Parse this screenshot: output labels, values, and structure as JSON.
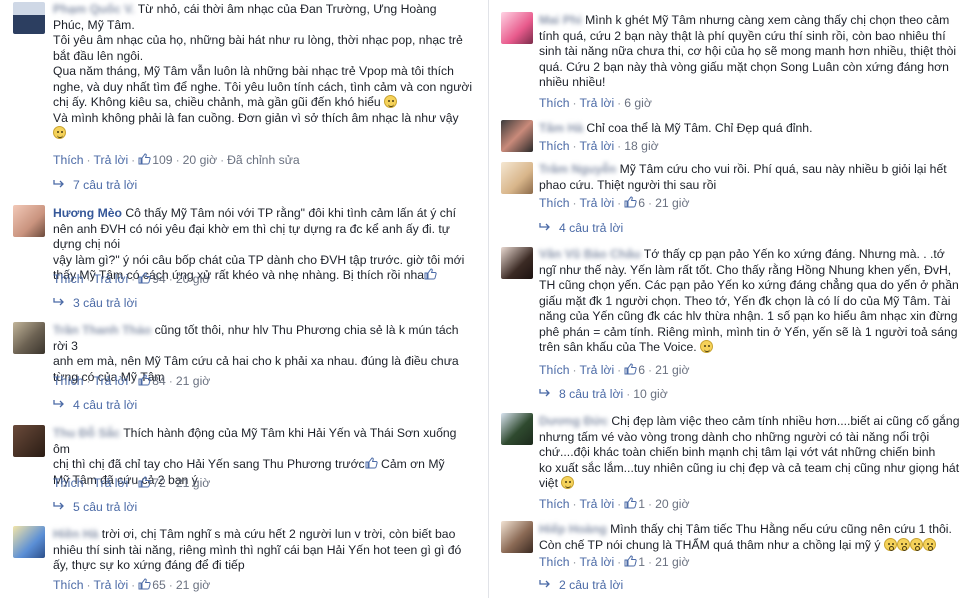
{
  "left": {
    "comments": [
      {
        "name": "Phạm Quốc V.",
        "avatar": "avatar-man",
        "text_lines": [
          "Từ nhỏ, cái thời âm nhạc của Đan Trường, Ưng Hoàng",
          "Phúc, Mỹ Tâm.",
          "Tôi yêu âm nhạc của họ, những bài hát như ru lòng, thời nhạc pop, nhạc trẻ",
          "bắt đầu lên ngôi.",
          "Qua năm tháng, Mỹ Tâm vẫn luôn là những bài nhạc trẻ Vpop mà tôi thích",
          "nghe, và duy nhất tìm để nghe. Tôi yêu luôn tính cách, tình cảm và con người",
          "chị ấy. Không kiêu sa, chiều chảnh, mà gần gũi đến khó hiểu",
          "Và mình không phải là fan cuồng. Đơn giản vì sở thích âm nhạc là như vậy"
        ],
        "like": "Thích",
        "reply": "Trả lời",
        "likes": "109",
        "time": "20 giờ",
        "edited": "Đã chỉnh sửa",
        "replies": "7 câu trả lời"
      },
      {
        "name": "Hương Mèo",
        "avatar": "avatar-girl",
        "text_lines": [
          "Cô thấy Mỹ Tâm nói với TP rằng\" đôi khi tình cảm lấn át ý chí",
          "nên anh ĐVH có nói yêu đại khờ em thì chị tự dựng ra đc",
          "vậy làm gì?\" ý nói câu bốp chát của TP dành cho ĐVH tập trước. giờ tôi mới",
          "thấy Mỹ Tâm có cách ứng xử rất khéo và nhẹ nhàng. Bị thích rồi nha"
        ],
        "text_line_tails": [
          "",
          " kể anh ấy đi. tự dựng chị nói",
          "",
          ""
        ],
        "like": "Thích",
        "reply": "Trả lời",
        "likes": "94",
        "time": "20 giờ",
        "replies": "3 câu trả lời"
      },
      {
        "name": "Trần Thanh Thảo",
        "avatar": "avatar-group",
        "text_lines": [
          "cũng tốt thôi, như hlv Thu Phương chia sẻ là k mún tách rời 3",
          "anh em mà, nên Mỹ Tâm cứu cả hai cho k phải xa nhau. đúng là điều chưa",
          "từng có của Mỹ Tâm"
        ],
        "like": "Thích",
        "reply": "Trả lời",
        "likes": "84",
        "time": "21 giờ",
        "replies": "4 câu trả lời"
      },
      {
        "name": "Thu Đỗ Sắc",
        "avatar": "avatar-dark",
        "text_lines": [
          "Thích hành động của Mỹ Tâm khi Hải Yến và Thái Sơn xuống ôm",
          "chị thì chị đã chỉ tay cho Hải Yến sang Thu Phương trước",
          "Mỹ Tâm đã cứu cả 2 bạn ý"
        ],
        "text_after_like": " Cảm ơn Mỹ",
        "like": "Thích",
        "reply": "Trả lời",
        "likes": "72",
        "time": "21 giờ",
        "replies": "5 câu trả lời"
      },
      {
        "name": "Hiền Hà",
        "avatar": "avatar-anime",
        "text_lines": [
          "trời ơi, chị Tâm nghĩ s mà cứu hết 2 người lun v trời, còn biết bao",
          "nhiêu thí sinh tài năng, riêng mình thì nghĩ cái bạn Hải Yến hot teen gì gì đó",
          "ấy, thực sự ko xứng đáng để đi tiếp"
        ],
        "like": "Thích",
        "reply": "Trả lời",
        "likes": "65",
        "time": "21 giờ"
      }
    ]
  },
  "right": {
    "comments": [
      {
        "name": "Mai Phi",
        "avatar": "avatar-pink",
        "text_lines": [
          "Mình k ghét Mỹ Tâm nhưng càng xem càng thấy chị chọn theo cảm",
          "tính quá, cứu 2 bạn này thật là phí quyền cứu thí sinh rồi, còn bao nhiêu thí",
          "sinh tài năng nữa chưa thi, cơ hội của họ sẽ mong manh hơn nhiều, thiệt thòi",
          "quá. Cứu 2 bạn này thà vòng giấu mặt chọn Song Luân còn xứng đáng hơn",
          "nhiều nhiều!"
        ],
        "like": "Thích",
        "reply": "Trả lời",
        "time": "6 giờ"
      },
      {
        "name": "Tâm Hà",
        "avatar": "avatar-photo",
        "text_lines": [
          "Chỉ coa thể là Mỹ Tâm. Chỉ Đẹp quá đỉnh."
        ],
        "like": "Thích",
        "reply": "Trả lời",
        "time": "18 giờ"
      },
      {
        "name": "Trâm Nguyễn",
        "avatar": "avatar-blond",
        "text_lines": [
          "Mỹ Tâm cứu cho vui rồi. Phí quá, sau này nhiều b giỏi lại hết",
          "phao cứu. Thiệt người thi sau rồi"
        ],
        "like": "Thích",
        "reply": "Trả lời",
        "likes": "6",
        "time": "21 giờ",
        "replies": "4 câu trả lời"
      },
      {
        "name": "Vân Vũ Bảo Châu",
        "avatar": "avatar-hair",
        "text_lines": [
          "Tớ thấy cp pạn pảo Yến ko xứng đáng.  Nhưng mà. . .tớ",
          "ngĩ như thế này. Yến làm rất tốt. Cho thấy rằng Hồng Nhung khen yến, ĐvH,",
          "TH cũng chọn yến. Các pạn pảo Yến ko xứng đáng chẳng qua do yến ở phần",
          "giấu mặt đk 1 người chọn. Theo tớ, Yến đk chọn là có lí do của Mỹ Tâm. Tài",
          "năng của Yến cũng đk các hlv thừa nhận. 1 số pạn ko hiểu âm nhạc xin đừng",
          "phê phán = cảm tính. Riêng mình, mình tin ở Yến, yến sẽ là 1 người toả sáng",
          "trên sân khấu của The Voice."
        ],
        "like": "Thích",
        "reply": "Trả lời",
        "likes": "6",
        "time": "21 giờ",
        "replies": "8 câu trả lời",
        "replies_time": "10 giờ"
      },
      {
        "name": "Dương Đức",
        "avatar": "avatar-boy",
        "text_lines": [
          "Chị đẹp làm việc theo cảm tính nhiều hơn....biết ai cũng cố gắng",
          "nhưng tấm vé vào vòng trong dành cho những người có tài năng nổi trội",
          "chứ....đội khác toàn chiến binh mạnh chị tâm lại vớt vát những chiến binh",
          "ko xuất sắc lắm...tuy nhiên cũng iu chị đẹp và cả team chị cũng như giọng hát",
          "việt"
        ],
        "like": "Thích",
        "reply": "Trả lời",
        "likes": "1",
        "time": "20 giờ"
      },
      {
        "name": "Hiếp Hoàng",
        "avatar": "avatar-glasses",
        "text_lines": [
          "Mình thấy chị Tâm tiếc Thu Hằng nếu cứu cũng nên cứu 1 thôi.",
          "Còn chế TP nói chung là THẨM quá thâm như a chồng lại mỹ ý"
        ],
        "like": "Thích",
        "reply": "Trả lời",
        "likes": "1",
        "time": "21 giờ",
        "replies": "2 câu trả lời"
      }
    ]
  }
}
